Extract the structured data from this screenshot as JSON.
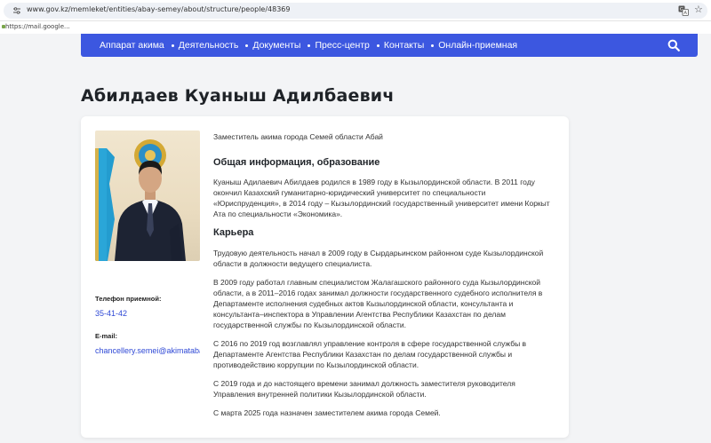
{
  "browser": {
    "url": "www.gov.kz/memleket/entities/abay-semey/about/structure/people/48369",
    "status_url": "https://mail.google..."
  },
  "nav": {
    "items": [
      "Аппарат акима",
      "Деятельность",
      "Документы",
      "Пресс-центр",
      "Контакты",
      "Онлайн-приемная"
    ]
  },
  "page": {
    "title": "Абилдаев Куаныш Адилбаевич"
  },
  "profile": {
    "position": "Заместитель акима города Семей области Абай",
    "phone_label": "Телефон приемной:",
    "phone": "35-41-42",
    "email_label": "E-mail:",
    "email": "chancellery.semei@akimatabai.gov.kz",
    "sections": [
      {
        "title": "Общая информация, образование",
        "paragraphs": [
          "Куаныш Адилаевич Абилдаев родился в 1989 году в Кызылординской области. В 2011 году окончил Казахский гуманитарно-юридический университет по специальности «Юриспруденция», в 2014 году – Кызылординский государственный университет имени Коркыт Ата по специальности «Экономика»."
        ]
      },
      {
        "title": "Карьера",
        "paragraphs": [
          "Трудовую деятельность начал в 2009 году в Сырдарьинском районном суде Кызылординской области в должности ведущего специалиста.",
          "В 2009 году работал главным специалистом Жалагашского районного суда Кызылординской области, а в 2011–2016 годах занимал должности государственного судебного исполнителя в Департаменте исполнения судебных актов Кызылординской области, консультанта и консультанта–инспектора в Управлении Агентства Республики Казахстан по делам государственной службы по Кызылординской области.",
          "С 2016 по 2019 год возглавлял управление контроля в сфере государственной службы в Департаменте Агентства Республики Казахстан по делам государственной службы и противодействию коррупции по Кызылординской области.",
          "С 2019 года и до настоящего времени занимал должность заместителя руководителя Управления внутренней политики Кызылординской области.",
          "С марта 2025 года назначен заместителем акима города Семей."
        ]
      }
    ]
  },
  "colors": {
    "nav_bg": "#3c57e0",
    "link": "#2f49d6"
  }
}
